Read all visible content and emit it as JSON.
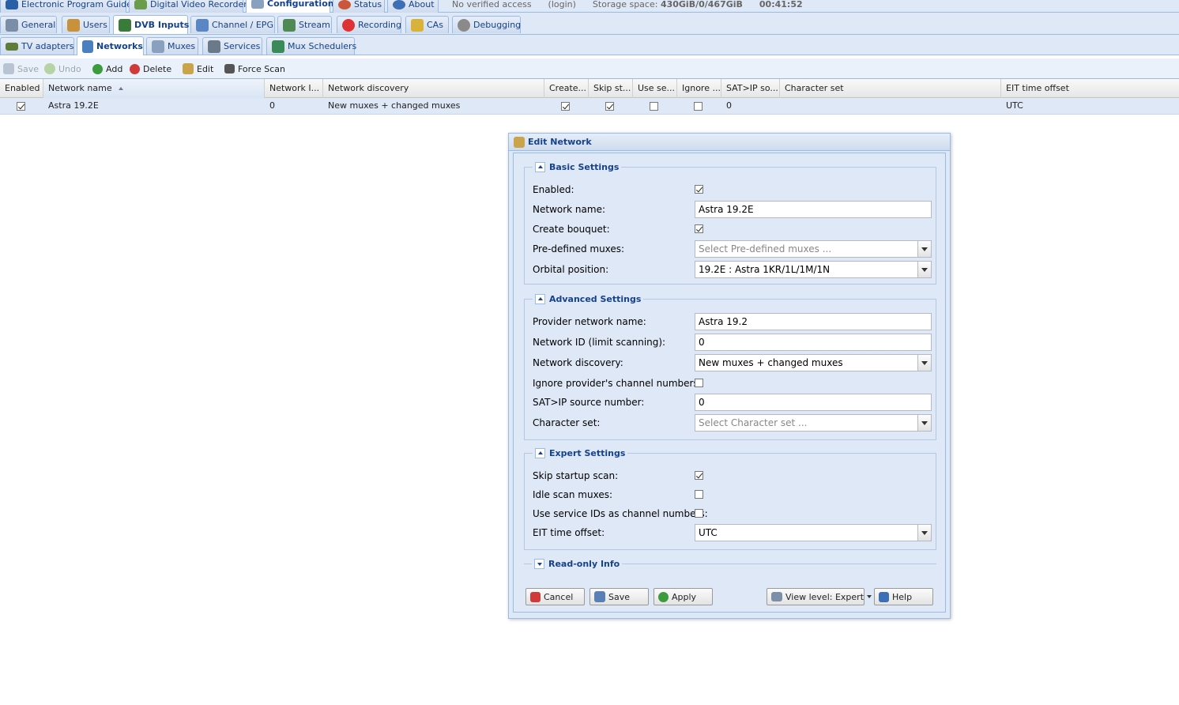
{
  "top_tabs": [
    {
      "label": "Electronic Program Guide",
      "icon": "epg-icon"
    },
    {
      "label": "Digital Video Recorder",
      "icon": "dvr-icon"
    },
    {
      "label": "Configuration",
      "icon": "wrench-icon",
      "active": true
    },
    {
      "label": "Status",
      "icon": "status-icon"
    },
    {
      "label": "About",
      "icon": "info-icon"
    }
  ],
  "status": {
    "access": "No verified access",
    "login": "(login)",
    "storage_label": "Storage space:",
    "storage_value": "430GiB/0/467GiB",
    "time": "00:41:52"
  },
  "config_tabs": [
    "General",
    "Users",
    "DVB Inputs",
    "Channel / EPG",
    "Stream",
    "Recording",
    "CAs",
    "Debugging"
  ],
  "dvb_tabs": [
    "TV adapters",
    "Networks",
    "Muxes",
    "Services",
    "Mux Schedulers"
  ],
  "toolbar": {
    "save": "Save",
    "undo": "Undo",
    "add": "Add",
    "delete": "Delete",
    "edit": "Edit",
    "force_scan": "Force Scan"
  },
  "grid": {
    "columns": [
      "Enabled",
      "Network name",
      "Network I...",
      "Network discovery",
      "Create...",
      "Skip st...",
      "Use se...",
      "Ignore ...",
      "SAT>IP so...",
      "Character set",
      "EIT time offset"
    ],
    "rows": [
      {
        "enabled": true,
        "name": "Astra 19.2E",
        "network_id": "0",
        "discovery": "New muxes + changed muxes",
        "create_bouquet": true,
        "skip_startup": true,
        "use_service_ids": false,
        "ignore_numbers": false,
        "satip_source": "0",
        "charset": "",
        "eit_offset": "UTC"
      }
    ]
  },
  "dialog": {
    "title": "Edit Network",
    "basic": {
      "legend": "Basic Settings",
      "enabled_label": "Enabled:",
      "enabled": true,
      "name_label": "Network name:",
      "name_value": "Astra 19.2E",
      "bouquet_label": "Create bouquet:",
      "bouquet": true,
      "predefined_label": "Pre-defined muxes:",
      "predefined_placeholder": "Select Pre-defined muxes ...",
      "orbital_label": "Orbital position:",
      "orbital_value": "19.2E : Astra 1KR/1L/1M/1N"
    },
    "advanced": {
      "legend": "Advanced Settings",
      "provider_label": "Provider network name:",
      "provider_value": "Astra 19.2",
      "netid_label": "Network ID (limit scanning):",
      "netid_value": "0",
      "discovery_label": "Network discovery:",
      "discovery_value": "New muxes + changed muxes",
      "ignore_label": "Ignore provider's channel numbers:",
      "ignore": false,
      "satip_label": "SAT>IP source number:",
      "satip_value": "0",
      "charset_label": "Character set:",
      "charset_placeholder": "Select Character set ..."
    },
    "expert": {
      "legend": "Expert Settings",
      "skip_label": "Skip startup scan:",
      "skip": true,
      "idle_label": "Idle scan muxes:",
      "idle": false,
      "sid_label": "Use service IDs as channel numbers:",
      "sid": false,
      "eit_label": "EIT time offset:",
      "eit_value": "UTC"
    },
    "readonly_legend": "Read-only Info",
    "buttons": {
      "cancel": "Cancel",
      "save": "Save",
      "apply": "Apply",
      "view_level": "View level: Expert",
      "help": "Help"
    }
  },
  "colors": {
    "panel_bg": "#dfe8f6",
    "border": "#99bbe8",
    "tab_text": "#15428b"
  }
}
